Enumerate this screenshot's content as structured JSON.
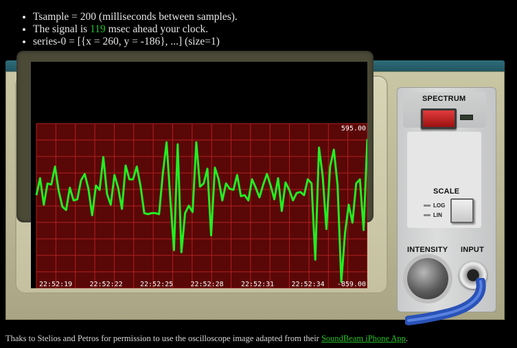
{
  "info": {
    "line1": "Tsample = 200 (milliseconds between samples).",
    "line2_prefix": "The signal is ",
    "line2_value": "119",
    "line2_suffix": " msec ahead your clock.",
    "line3": "series-0 = [{x = 260, y = -186}, ...] (size=1)"
  },
  "scope": {
    "max_label": "595.00",
    "min_label": "-859.00",
    "trace_color": "#22ee22",
    "grid_color": "#b32020",
    "screen_color": "#5a0707"
  },
  "panel": {
    "spectrum_label": "SPECTRUM",
    "scale_label": "SCALE",
    "log_label": "LOG",
    "lin_label": "LIN",
    "intensity_label": "INTENSITY",
    "input_label": "INPUT"
  },
  "footer": {
    "text": "Thaks to Stelios and Petros for permission to use the oscilloscope image adapted from their ",
    "link": "SoundBeam iPhone App",
    "end": "."
  },
  "chart_data": {
    "type": "line",
    "x": [
      "22:52:19",
      "22:52:22",
      "22:52:25",
      "22:52:28",
      "22:52:31",
      "22:52:34"
    ],
    "ylim": [
      -859,
      595
    ],
    "grid": true,
    "series": [
      {
        "values": [
          -30,
          130,
          -120,
          80,
          70,
          240,
          10,
          -140,
          -170,
          40,
          -80,
          -70,
          110,
          170,
          30,
          -220,
          60,
          20,
          330,
          -20,
          -120,
          160,
          40,
          -160,
          250,
          120,
          120,
          240,
          60,
          -200,
          -210,
          -200,
          -200,
          -210,
          170,
          470,
          -60,
          -550,
          450,
          -570,
          -200,
          -130,
          -190,
          470,
          50,
          80,
          220,
          -410,
          230,
          120,
          -80,
          80,
          30,
          20,
          160,
          -40,
          -30,
          -80,
          120,
          40,
          -50,
          70,
          170,
          60,
          -70,
          130,
          -180,
          90,
          20,
          -80,
          -10,
          0,
          -30,
          120,
          80,
          -640,
          420,
          150,
          -350,
          240,
          400,
          60,
          -850,
          -390,
          -120,
          -290,
          80,
          120,
          -360,
          500
        ]
      }
    ]
  }
}
